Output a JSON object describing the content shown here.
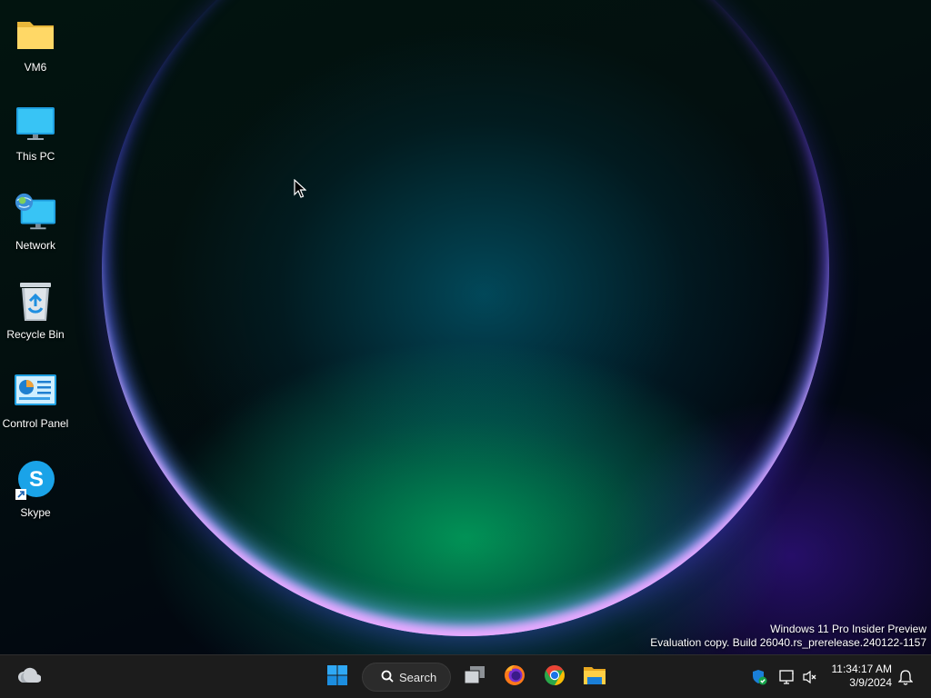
{
  "desktop": {
    "icons": [
      {
        "label": "VM6",
        "icon": "folder-icon"
      },
      {
        "label": "This PC",
        "icon": "monitor-icon"
      },
      {
        "label": "Network",
        "icon": "network-icon"
      },
      {
        "label": "Recycle Bin",
        "icon": "recycle-bin-icon"
      },
      {
        "label": "Control Panel",
        "icon": "control-panel-icon"
      },
      {
        "label": "Skype",
        "icon": "skype-icon"
      }
    ],
    "watermark": {
      "line1": "Windows 11 Pro Insider Preview",
      "line2": "Evaluation copy. Build 26040.rs_prerelease.240122-1157"
    }
  },
  "taskbar": {
    "search_label": "Search",
    "pinned": [
      "start-icon",
      "task-view-icon",
      "firefox-icon",
      "chrome-icon",
      "file-explorer-icon"
    ],
    "tray": {
      "icons": [
        "windows-security-icon",
        "network-status-icon",
        "volume-muted-icon",
        "notification-bell-icon"
      ],
      "time": "11:34:17 AM",
      "date": "3/9/2024"
    },
    "widget_icon": "weather-icon"
  },
  "colors": {
    "taskbar_bg": "#1c1c1c",
    "accent": "#0078d4"
  }
}
